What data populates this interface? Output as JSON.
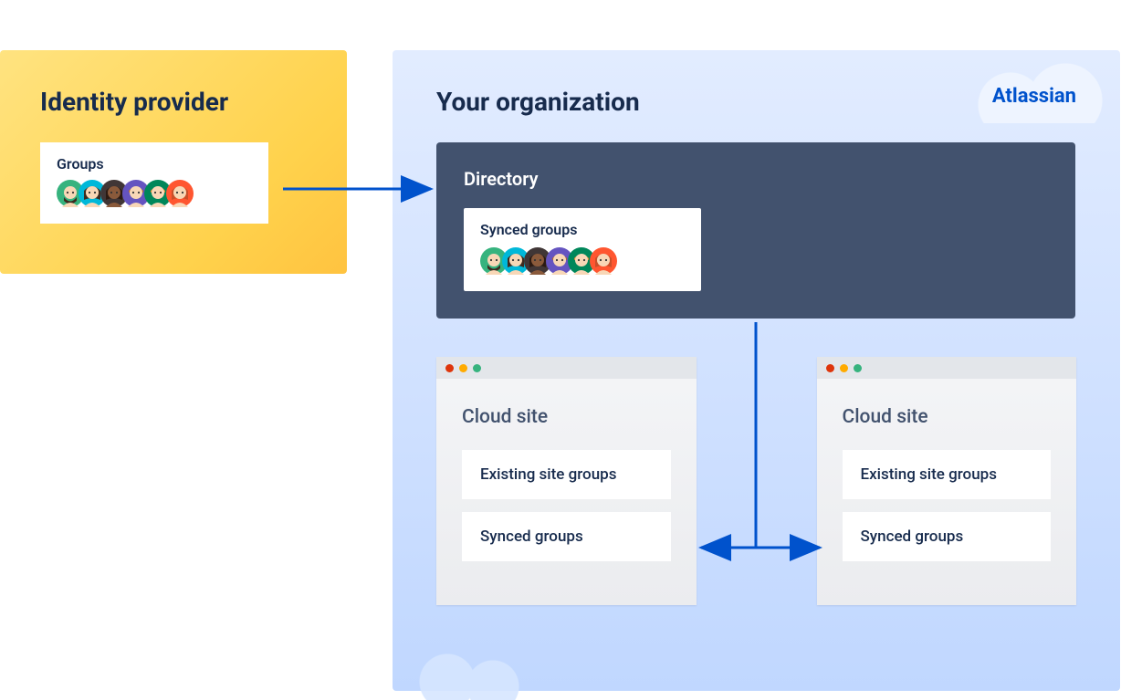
{
  "idp": {
    "title": "Identity provider",
    "groups_label": "Groups"
  },
  "org": {
    "title": "Your organization",
    "brand": "Atlassian",
    "directory": {
      "title": "Directory",
      "synced_label": "Synced groups"
    },
    "sites": [
      {
        "title": "Cloud site",
        "existing_label": "Existing site groups",
        "synced_label": "Synced groups"
      },
      {
        "title": "Cloud site",
        "existing_label": "Existing site groups",
        "synced_label": "Synced groups"
      }
    ]
  },
  "avatars": [
    {
      "bg": "#36b37e",
      "type": "beard"
    },
    {
      "bg": "#00b8d9",
      "type": "woman1"
    },
    {
      "bg": "#403636",
      "type": "woman2"
    },
    {
      "bg": "#6554c0",
      "type": "man1"
    },
    {
      "bg": "#00875a",
      "type": "man2"
    },
    {
      "bg": "#ff5630",
      "type": "woman3"
    }
  ]
}
